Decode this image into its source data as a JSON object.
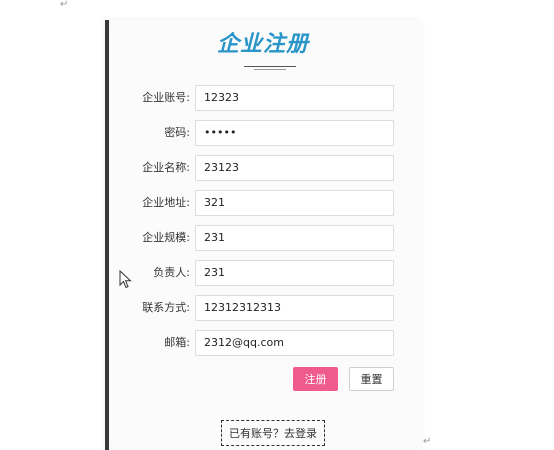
{
  "form": {
    "title": "企业注册",
    "fields": [
      {
        "label": "企业账号:",
        "value": "12323"
      },
      {
        "label": "密码:",
        "value": "•••••"
      },
      {
        "label": "企业名称:",
        "value": "23123"
      },
      {
        "label": "企业地址:",
        "value": "321"
      },
      {
        "label": "企业规模:",
        "value": "231"
      },
      {
        "label": "负责人:",
        "value": "231"
      },
      {
        "label": "联系方式:",
        "value": "12312312313"
      },
      {
        "label": "邮箱:",
        "value": "2312@qq.com"
      }
    ],
    "register_label": "注册",
    "reset_label": "重置",
    "login_link": "已有账号？去登录"
  },
  "colors": {
    "title": "#2a95c8",
    "register_button": "#ef5b8c",
    "panel_background": "#fbfbfb",
    "left_bar": "#3a3a3a"
  },
  "icons": {
    "cursor": "mouse-pointer-icon",
    "paragraph_mark": "return-arrow-icon"
  }
}
